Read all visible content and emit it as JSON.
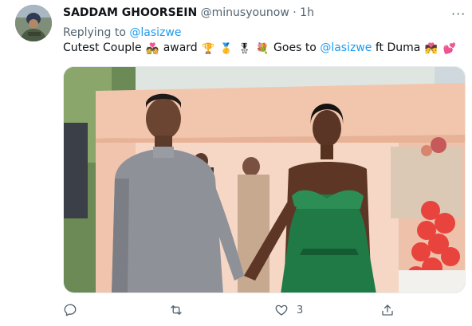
{
  "tweet": {
    "author_name": "SADDAM GHOORSEIN",
    "author_handle": "@minusyounow",
    "separator": "·",
    "time": "1h",
    "more_label": "···",
    "reply_prefix": "Replying to",
    "reply_mention": "@lasizwe",
    "text_start": "Cutest Couple",
    "text_award": "award",
    "text_goes": "Goes to",
    "text_mention": "@lasizwe",
    "text_end": "ft Duma",
    "emojis": {
      "couple": "💑",
      "trophy": "🏆",
      "medal1": "🥇",
      "medal2": "🎖",
      "bouquet": "💐",
      "kiss": "💏",
      "heart": "💕"
    }
  },
  "actions": {
    "reply_count": "",
    "retweet_count": "",
    "like_count": "3"
  },
  "colors": {
    "accent": "#1d9bf0",
    "secondary_text": "#536471"
  }
}
